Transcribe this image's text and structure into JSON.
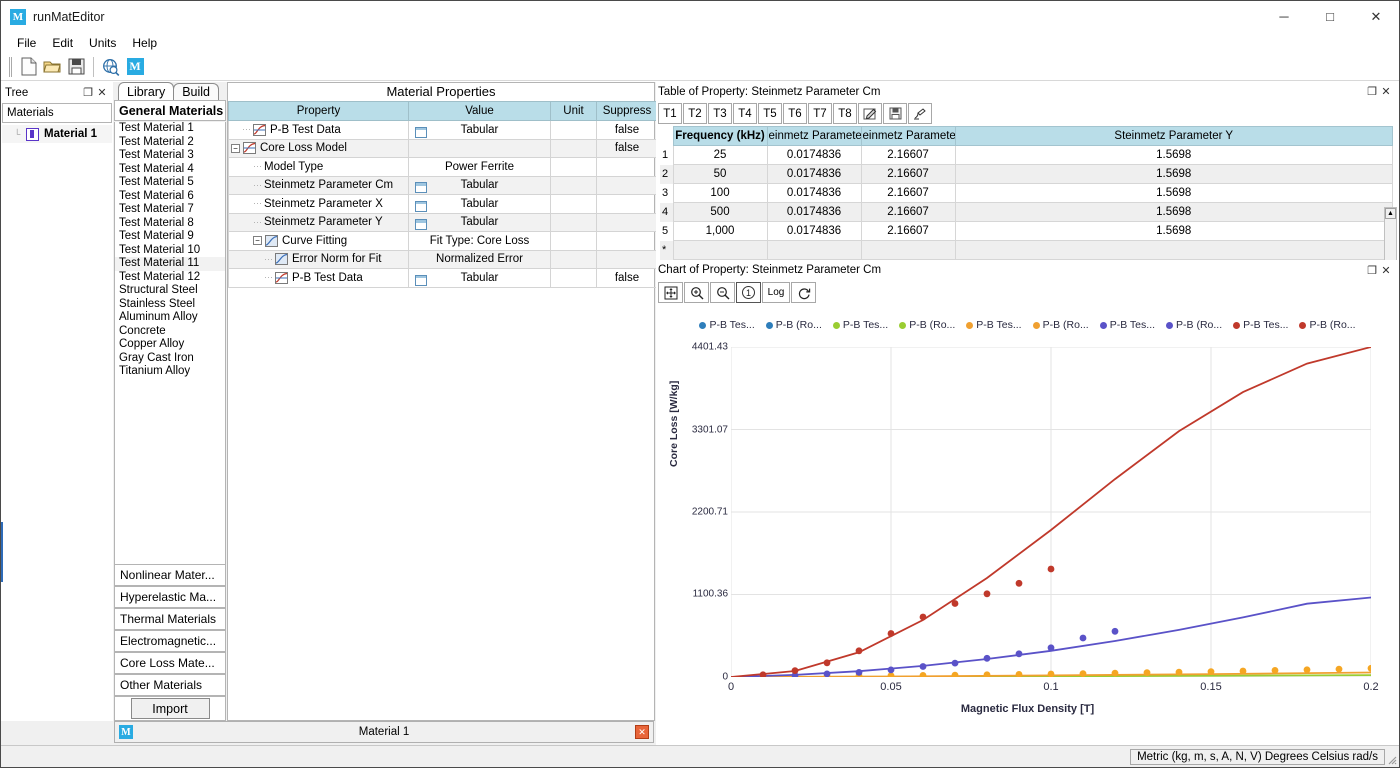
{
  "window": {
    "title": "runMatEditor",
    "icon": "M",
    "minimize": "─",
    "maximize": "□",
    "close": "✕"
  },
  "menubar": {
    "items": [
      "File",
      "Edit",
      "Units",
      "Help"
    ]
  },
  "toolbar": {
    "buttons": [
      {
        "name": "new-file-icon",
        "label": ""
      },
      {
        "name": "open-folder-icon",
        "label": ""
      },
      {
        "name": "save-icon",
        "label": ""
      },
      {
        "name": "globe-search-icon",
        "label": ""
      },
      {
        "name": "engineering-data-icon",
        "label": "M"
      }
    ]
  },
  "tree_panel": {
    "caption": "Tree",
    "float_icon": "❐",
    "close_icon": "✕",
    "header": "Materials",
    "nodes": [
      {
        "label": "Material 1"
      }
    ]
  },
  "library_panel": {
    "tabs": [
      {
        "label": "Library",
        "active": true
      },
      {
        "label": "Build",
        "active": false
      }
    ],
    "header": "General Materials",
    "items": [
      "Test Material 1",
      "Test Material 2",
      "Test Material 3",
      "Test Material 4",
      "Test Material 5",
      "Test Material 6",
      "Test Material 7",
      "Test Material 8",
      "Test Material 9",
      "Test Material 10",
      "Test Material 11",
      "Test Material 12",
      "Structural Steel",
      "Stainless Steel",
      "Aluminum Alloy",
      "Concrete",
      "Copper Alloy",
      "Gray Cast Iron",
      "Titanium Alloy"
    ],
    "selected_item": "Test Material 11",
    "category_buttons": [
      "Nonlinear Mater...",
      "Hyperelastic Ma...",
      "Thermal Materials",
      "Electromagnetic...",
      "Core Loss Mate...",
      "Other Materials"
    ],
    "import_button": "Import"
  },
  "material_properties": {
    "title": "Material Properties",
    "columns": [
      "Property",
      "Value",
      "Unit",
      "Suppress"
    ],
    "rows": [
      {
        "indent": 1,
        "expander": "",
        "icon": "curve-icon",
        "property": "P-B Test Data",
        "value": "Tabular",
        "value_icon": "grid-icon",
        "unit": "",
        "suppress": "false",
        "alt": false
      },
      {
        "indent": 0,
        "expander": "−",
        "icon": "curve-icon",
        "property": "Core Loss Model",
        "value": "",
        "value_icon": "",
        "unit": "",
        "suppress": "false",
        "alt": true
      },
      {
        "indent": 2,
        "expander": "",
        "icon": "",
        "property": "Model Type",
        "value": "Power Ferrite",
        "value_icon": "",
        "unit": "",
        "suppress": "",
        "alt": false
      },
      {
        "indent": 2,
        "expander": "",
        "icon": "",
        "property": "Steinmetz Parameter Cm",
        "value": "Tabular",
        "value_icon": "grid-icon",
        "unit": "",
        "suppress": "",
        "alt": true
      },
      {
        "indent": 2,
        "expander": "",
        "icon": "",
        "property": "Steinmetz Parameter X",
        "value": "Tabular",
        "value_icon": "grid-icon",
        "unit": "",
        "suppress": "",
        "alt": false
      },
      {
        "indent": 2,
        "expander": "",
        "icon": "",
        "property": "Steinmetz Parameter Y",
        "value": "Tabular",
        "value_icon": "grid-icon",
        "unit": "",
        "suppress": "",
        "alt": true
      },
      {
        "indent": 2,
        "expander": "−",
        "icon": "curve-icon",
        "property": "Curve Fitting",
        "value": "Fit Type: Core Loss",
        "value_icon": "",
        "unit": "",
        "suppress": "",
        "alt": false
      },
      {
        "indent": 3,
        "expander": "",
        "icon": "curve-icon",
        "property": "Error Norm for Fit",
        "value": "Normalized Error",
        "value_icon": "",
        "unit": "",
        "suppress": "",
        "alt": true
      },
      {
        "indent": 3,
        "expander": "",
        "icon": "curve-icon",
        "property": "P-B Test Data",
        "value": "Tabular",
        "value_icon": "grid-icon",
        "unit": "",
        "suppress": "false",
        "alt": false
      }
    ]
  },
  "table_panel": {
    "caption": "Table of Property: Steinmetz Parameter Cm",
    "float_icon": "❐",
    "close_icon": "✕",
    "toolbar": [
      "T1",
      "T2",
      "T3",
      "T4",
      "T5",
      "T6",
      "T7",
      "T8"
    ],
    "toolbar_icons": [
      "edit-icon",
      "save-icon",
      "clear-icon"
    ],
    "columns": [
      "Frequency (kHz)",
      "einmetz Parameter C",
      "einmetz Parameter",
      "Steinmetz Parameter Y"
    ],
    "rows": [
      {
        "n": "1",
        "cells": [
          "25",
          "0.0174836",
          "2.16607",
          "1.5698"
        ]
      },
      {
        "n": "2",
        "cells": [
          "50",
          "0.0174836",
          "2.16607",
          "1.5698"
        ]
      },
      {
        "n": "3",
        "cells": [
          "100",
          "0.0174836",
          "2.16607",
          "1.5698"
        ]
      },
      {
        "n": "4",
        "cells": [
          "500",
          "0.0174836",
          "2.16607",
          "1.5698"
        ]
      },
      {
        "n": "5",
        "cells": [
          "1,000",
          "0.0174836",
          "2.16607",
          "1.5698"
        ]
      },
      {
        "n": "*",
        "cells": [
          "",
          "",
          "",
          ""
        ]
      }
    ]
  },
  "chart_panel": {
    "caption": "Chart of Property: Steinmetz Parameter Cm",
    "float_icon": "❐",
    "close_icon": "✕",
    "toolbar": [
      {
        "name": "fit-to-window-button",
        "label": ""
      },
      {
        "name": "zoom-in-button",
        "label": ""
      },
      {
        "name": "zoom-out-button",
        "label": ""
      },
      {
        "name": "info-button",
        "label": "1"
      },
      {
        "name": "log-scale-button",
        "label": "Log"
      },
      {
        "name": "refresh-button",
        "label": ""
      }
    ]
  },
  "chart_data": {
    "type": "scatter",
    "title": "",
    "xlabel": "Magnetic Flux Density [T]",
    "ylabel": "Core Loss [W/kg]",
    "xlim": [
      0,
      0.2
    ],
    "ylim": [
      0,
      4401.43
    ],
    "xticks": [
      0,
      0.05,
      0.1,
      0.15,
      0.2
    ],
    "xtick_labels": [
      "0",
      "0.05",
      "0.1",
      "0.15",
      "0.2"
    ],
    "yticks": [
      0,
      1100.36,
      2200.71,
      3301.07,
      4401.43
    ],
    "ytick_labels": [
      "0",
      "1100.36",
      "2200.71",
      "3301.07",
      "4401.43"
    ],
    "grid": true,
    "legend_position": "top",
    "legend": [
      {
        "label": "P-B Tes...",
        "color": "#2e7ebb"
      },
      {
        "label": "P-B (Ro...",
        "color": "#2e7ebb"
      },
      {
        "label": "P-B Tes...",
        "color": "#9acd32"
      },
      {
        "label": "P-B (Ro...",
        "color": "#9acd32"
      },
      {
        "label": "P-B Tes...",
        "color": "#f0a030"
      },
      {
        "label": "P-B (Ro...",
        "color": "#f0a030"
      },
      {
        "label": "P-B Tes...",
        "color": "#5a52c8"
      },
      {
        "label": "P-B (Ro...",
        "color": "#5a52c8"
      },
      {
        "label": "P-B Tes...",
        "color": "#c0392b"
      },
      {
        "label": "P-B (Ro...",
        "color": "#c0392b"
      }
    ],
    "series": [
      {
        "name": "P-B Test Data 25 kHz",
        "color": "#9acd32",
        "kind": "line",
        "x": [
          0,
          0.05,
          0.1,
          0.15,
          0.2
        ],
        "y": [
          0,
          3,
          9,
          17,
          26
        ]
      },
      {
        "name": "P-B Test Data 50 kHz",
        "color": "#f0a030",
        "kind": "line",
        "x": [
          0,
          0.05,
          0.1,
          0.15,
          0.2
        ],
        "y": [
          0,
          7,
          21,
          39,
          60
        ]
      },
      {
        "name": "P-B Test Data 50 kHz points",
        "color": "#f5a623",
        "kind": "scatter",
        "x": [
          0.01,
          0.02,
          0.03,
          0.04,
          0.05,
          0.06,
          0.07,
          0.08,
          0.09,
          0.1,
          0.11,
          0.12,
          0.13,
          0.14,
          0.15,
          0.16,
          0.17,
          0.18,
          0.19,
          0.2
        ],
        "y": [
          10,
          12,
          14,
          16,
          19,
          22,
          26,
          30,
          35,
          40,
          46,
          52,
          58,
          64,
          72,
          80,
          88,
          96,
          106,
          116
        ]
      },
      {
        "name": "P-B Test Data 500 kHz",
        "color": "#5a52c8",
        "kind": "line",
        "x": [
          0,
          0.02,
          0.04,
          0.06,
          0.08,
          0.1,
          0.12,
          0.14,
          0.16,
          0.18,
          0.2
        ],
        "y": [
          0,
          28,
          78,
          148,
          240,
          350,
          480,
          628,
          795,
          978,
          1060
        ]
      },
      {
        "name": "P-B Test Data 500 kHz points",
        "color": "#5a52c8",
        "kind": "scatter",
        "x": [
          0.01,
          0.02,
          0.03,
          0.04,
          0.05,
          0.06,
          0.07,
          0.08,
          0.09,
          0.1,
          0.11,
          0.12
        ],
        "y": [
          8,
          22,
          42,
          62,
          95,
          140,
          185,
          250,
          310,
          390,
          520,
          610
        ]
      },
      {
        "name": "P-B Test Data 1000 kHz",
        "color": "#c0392b",
        "kind": "line",
        "x": [
          0,
          0.02,
          0.04,
          0.06,
          0.08,
          0.1,
          0.12,
          0.14,
          0.16,
          0.18,
          0.2
        ],
        "y": [
          0,
          80,
          330,
          760,
          1320,
          1960,
          2640,
          3280,
          3800,
          4180,
          4401
        ]
      },
      {
        "name": "P-B Test Data 1000 kHz points",
        "color": "#c0392b",
        "kind": "scatter",
        "x": [
          0.01,
          0.02,
          0.03,
          0.04,
          0.05,
          0.06,
          0.07,
          0.08,
          0.09,
          0.1
        ],
        "y": [
          30,
          85,
          190,
          350,
          580,
          800,
          980,
          1110,
          1250,
          1440
        ]
      }
    ]
  },
  "material_status": {
    "icon": "M",
    "label": "Material 1",
    "close_icon": "✕"
  },
  "statusbar": {
    "units": "Metric (kg, m, s, A, N, V)  Degrees  Celsius  rad/s"
  }
}
